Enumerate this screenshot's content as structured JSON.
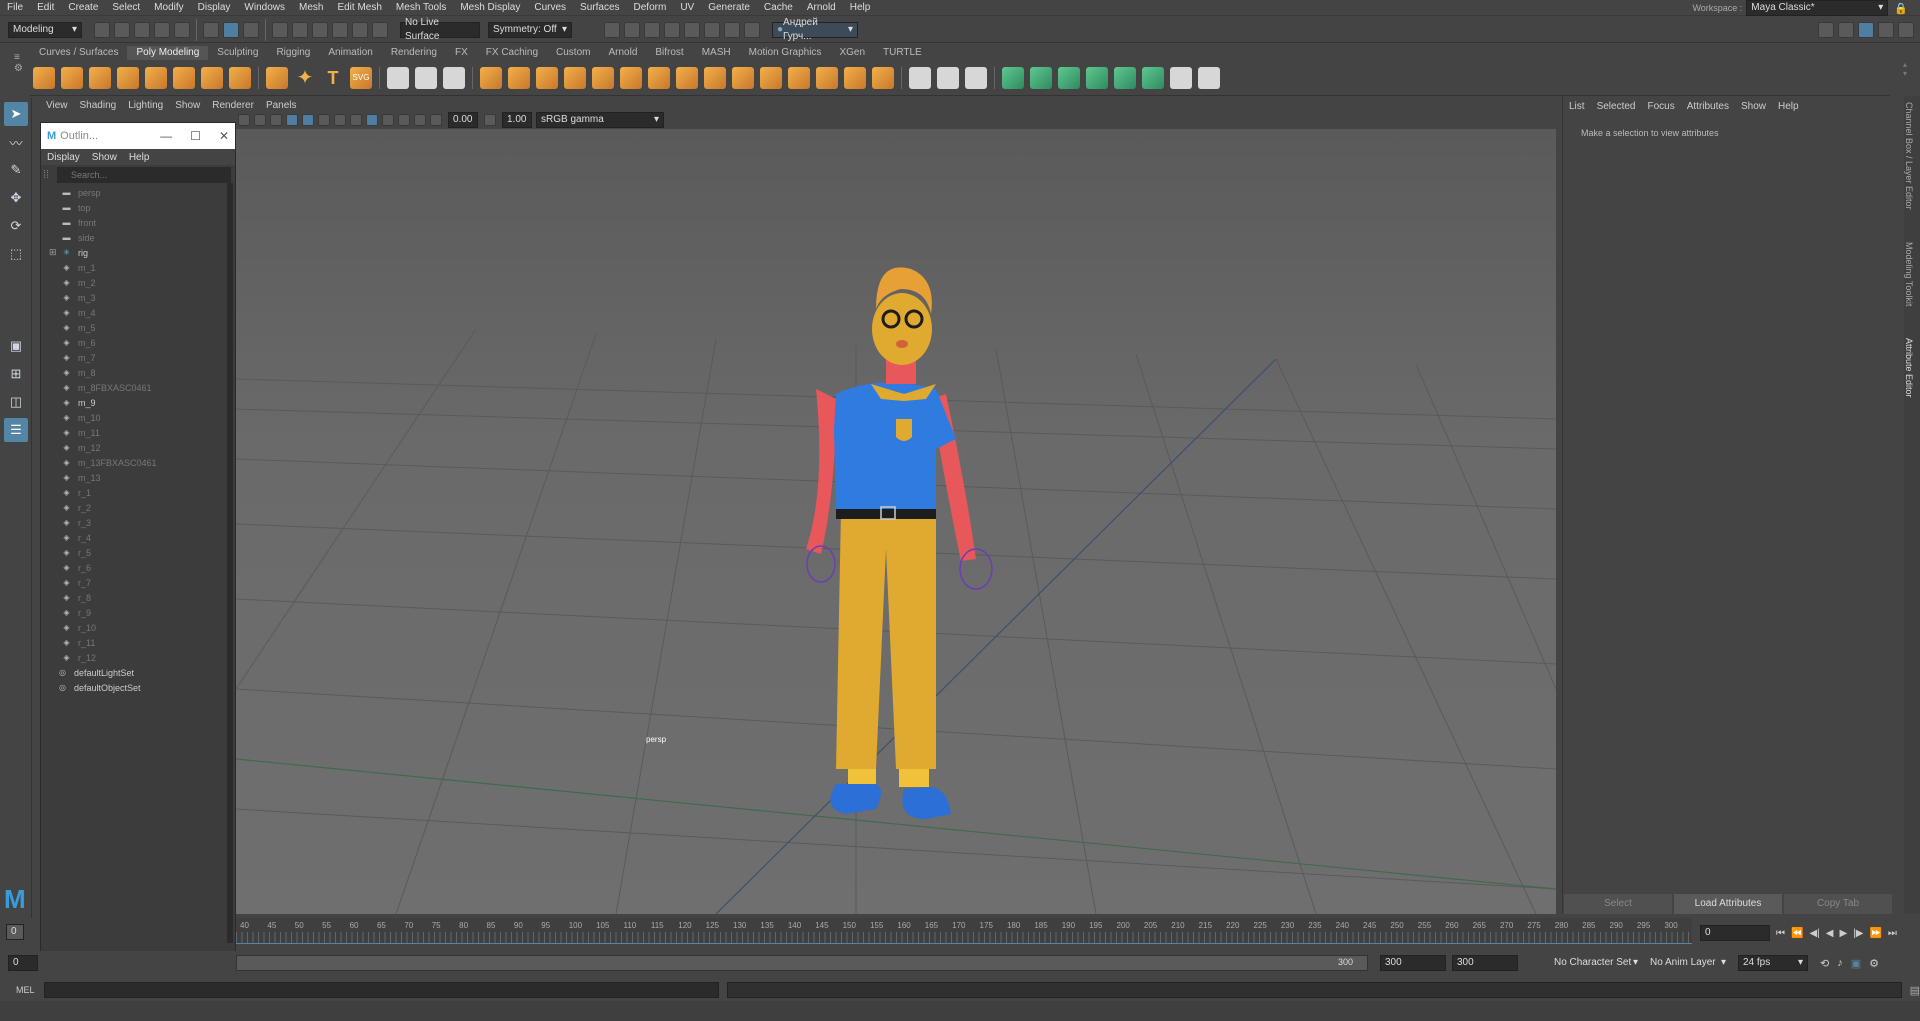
{
  "menubar": {
    "items": [
      "File",
      "Edit",
      "Create",
      "Select",
      "Modify",
      "Display",
      "Windows",
      "Mesh",
      "Edit Mesh",
      "Mesh Tools",
      "Mesh Display",
      "Curves",
      "Surfaces",
      "Deform",
      "UV",
      "Generate",
      "Cache",
      "Arnold",
      "Help"
    ],
    "workspace_label": "Workspace :",
    "workspace_value": "Maya Classic*"
  },
  "statusline": {
    "mode": "Modeling",
    "live_surface": "No Live Surface",
    "symmetry": "Symmetry: Off",
    "user": "Андрей Гурч..."
  },
  "shelf": {
    "tabs": [
      "Curves / Surfaces",
      "Poly Modeling",
      "Sculpting",
      "Rigging",
      "Animation",
      "Rendering",
      "FX",
      "FX Caching",
      "Custom",
      "Arnold",
      "Bifrost",
      "MASH",
      "Motion Graphics",
      "XGen",
      "TURTLE"
    ],
    "active_tab": "Poly Modeling"
  },
  "viewport": {
    "menus": [
      "View",
      "Shading",
      "Lighting",
      "Show",
      "Renderer",
      "Panels"
    ],
    "exposure": "0.00",
    "gamma": "1.00",
    "color_space": "sRGB gamma",
    "camera_label": "persp"
  },
  "outliner": {
    "title": "Outlin...",
    "menus": [
      "Display",
      "Show",
      "Help"
    ],
    "search_placeholder": "Search...",
    "items": [
      {
        "label": "persp",
        "icon": "camera-icon",
        "bright": false
      },
      {
        "label": "top",
        "icon": "camera-icon",
        "bright": false
      },
      {
        "label": "front",
        "icon": "camera-icon",
        "bright": false
      },
      {
        "label": "side",
        "icon": "camera-icon",
        "bright": false
      },
      {
        "label": "rig",
        "icon": "joint-icon",
        "bright": true,
        "expand": true
      },
      {
        "label": "m_1",
        "icon": "mesh-icon",
        "bright": false
      },
      {
        "label": "m_2",
        "icon": "mesh-icon",
        "bright": false
      },
      {
        "label": "m_3",
        "icon": "mesh-icon",
        "bright": false
      },
      {
        "label": "m_4",
        "icon": "mesh-icon",
        "bright": false
      },
      {
        "label": "m_5",
        "icon": "mesh-icon",
        "bright": false
      },
      {
        "label": "m_6",
        "icon": "mesh-icon",
        "bright": false
      },
      {
        "label": "m_7",
        "icon": "mesh-icon",
        "bright": false
      },
      {
        "label": "m_8",
        "icon": "mesh-icon",
        "bright": false
      },
      {
        "label": "m_8FBXASC0461",
        "icon": "mesh-icon",
        "bright": false
      },
      {
        "label": "m_9",
        "icon": "mesh-icon",
        "bright": true
      },
      {
        "label": "m_10",
        "icon": "mesh-icon",
        "bright": false
      },
      {
        "label": "m_11",
        "icon": "mesh-icon",
        "bright": false
      },
      {
        "label": "m_12",
        "icon": "mesh-icon",
        "bright": false
      },
      {
        "label": "m_13FBXASC0461",
        "icon": "mesh-icon",
        "bright": false
      },
      {
        "label": "m_13",
        "icon": "mesh-icon",
        "bright": false
      },
      {
        "label": "r_1",
        "icon": "mesh-icon",
        "bright": false
      },
      {
        "label": "r_2",
        "icon": "mesh-icon",
        "bright": false
      },
      {
        "label": "r_3",
        "icon": "mesh-icon",
        "bright": false
      },
      {
        "label": "r_4",
        "icon": "mesh-icon",
        "bright": false
      },
      {
        "label": "r_5",
        "icon": "mesh-icon",
        "bright": false
      },
      {
        "label": "r_6",
        "icon": "mesh-icon",
        "bright": false
      },
      {
        "label": "r_7",
        "icon": "mesh-icon",
        "bright": false
      },
      {
        "label": "r_8",
        "icon": "mesh-icon",
        "bright": false
      },
      {
        "label": "r_9",
        "icon": "mesh-icon",
        "bright": false
      },
      {
        "label": "r_10",
        "icon": "mesh-icon",
        "bright": false
      },
      {
        "label": "r_11",
        "icon": "mesh-icon",
        "bright": false
      },
      {
        "label": "r_12",
        "icon": "mesh-icon",
        "bright": false
      },
      {
        "label": "defaultLightSet",
        "icon": "set-icon",
        "bright": true
      },
      {
        "label": "defaultObjectSet",
        "icon": "set-icon",
        "bright": true
      }
    ]
  },
  "attribute_editor": {
    "menus": [
      "List",
      "Selected",
      "Focus",
      "Attributes",
      "Show",
      "Help"
    ],
    "message": "Make a selection to view attributes",
    "buttons": [
      "Select",
      "Load Attributes",
      "Copy Tab"
    ],
    "side_tabs": [
      "Channel Box / Layer Editor",
      "Modeling Toolkit",
      "Attribute Editor"
    ]
  },
  "timeline": {
    "ticks": [
      "40",
      "45",
      "50",
      "55",
      "60",
      "65",
      "70",
      "75",
      "80",
      "85",
      "90",
      "95",
      "100",
      "105",
      "110",
      "115",
      "120",
      "125",
      "130",
      "135",
      "140",
      "145",
      "150",
      "155",
      "160",
      "165",
      "170",
      "175",
      "180",
      "185",
      "190",
      "195",
      "200",
      "205",
      "210",
      "215",
      "220",
      "225",
      "230",
      "235",
      "240",
      "245",
      "250",
      "255",
      "260",
      "265",
      "270",
      "275",
      "280",
      "285",
      "290",
      "295",
      "300"
    ],
    "current_frame": "0"
  },
  "range": {
    "start": "0",
    "current": "0",
    "slider_end": "300",
    "end1": "300",
    "end2": "300",
    "character_set": "No Character Set",
    "anim_layer": "No Anim Layer",
    "fps": "24 fps"
  },
  "cmdline": {
    "label": "MEL"
  },
  "colors": {
    "accent": "#5285a6",
    "bg": "#444444"
  }
}
